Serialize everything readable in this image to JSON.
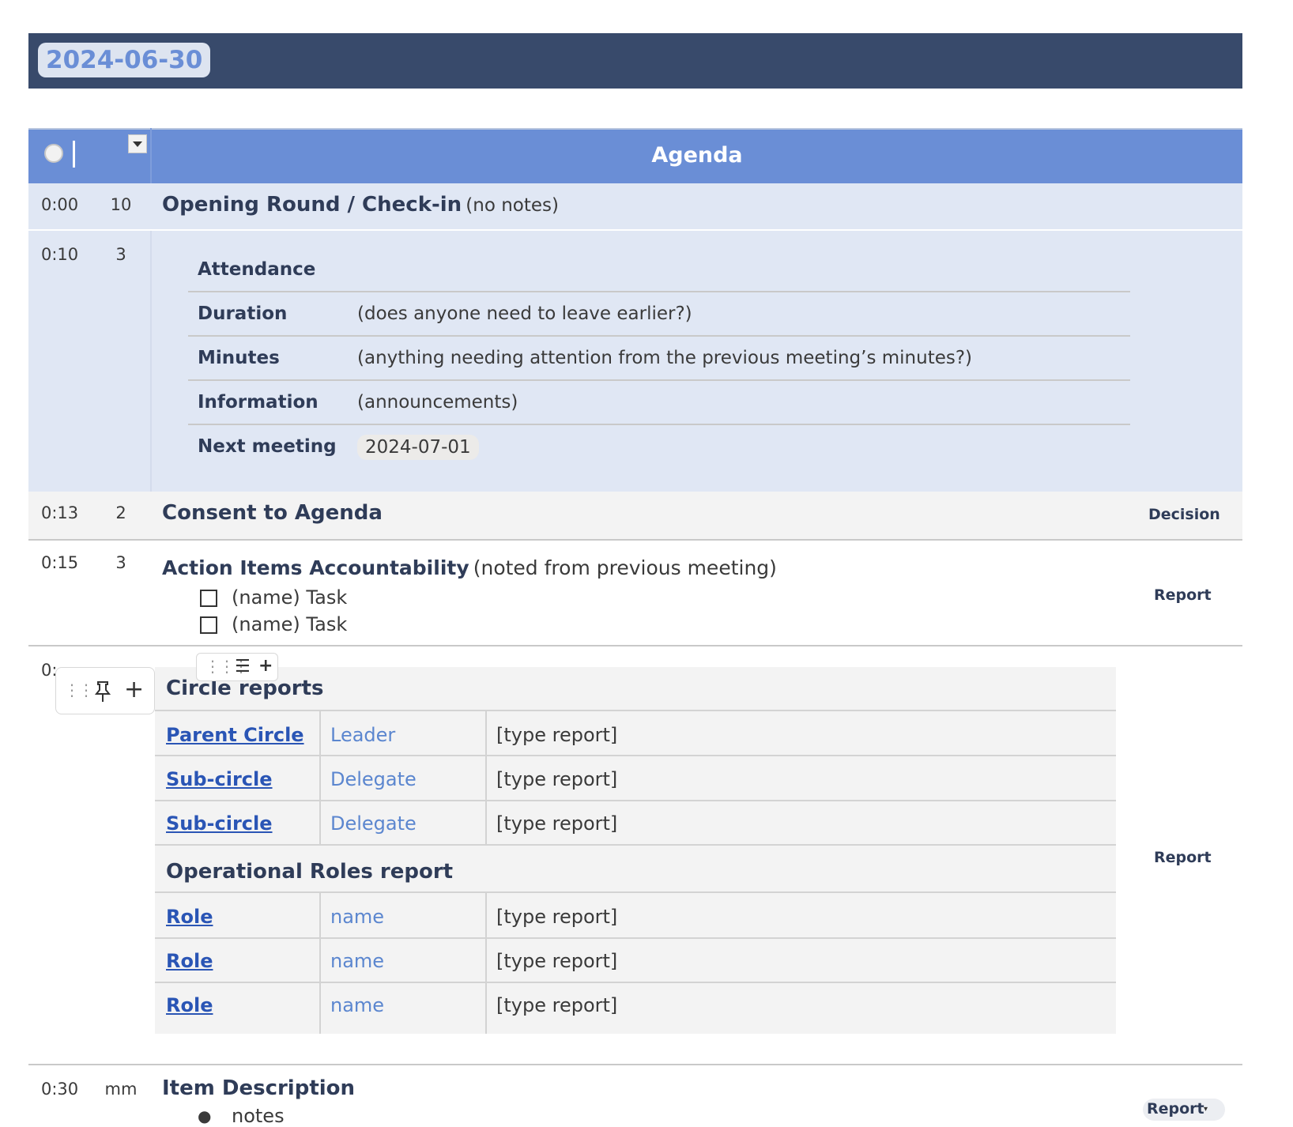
{
  "header": {
    "date": "2024-06-30",
    "agenda_title": "Agenda"
  },
  "icons": {
    "clock": "clock-icon",
    "dropdown": "dropdown-icon",
    "pin": "pin-icon",
    "add": "plus-icon",
    "drag": "drag-handle-icon",
    "align": "align-icon"
  },
  "rows": [
    {
      "time": "0:00",
      "duration": "10",
      "title": "Opening Round / Check-in",
      "note": "(no notes)"
    },
    {
      "time": "0:10",
      "duration": "3"
    },
    {
      "time": "0:13",
      "duration": "2",
      "title": "Consent to Agenda",
      "type": "Decision"
    },
    {
      "time": "0:15",
      "duration": "3",
      "title": "Action Items Accountability",
      "note": "(noted from previous meeting)",
      "type": "Report",
      "tasks": [
        "(name) Task",
        "(name) Task"
      ]
    },
    {
      "time": "0:",
      "type": "Report"
    },
    {
      "time": "0:30",
      "duration": "mm",
      "title": "Item Description",
      "bullet": "notes",
      "type": "Report"
    }
  ],
  "attendance": {
    "title": "Attendance",
    "items": [
      {
        "label": "Duration",
        "value": "(does anyone need to leave earlier?)"
      },
      {
        "label": "Minutes",
        "value": "(anything needing attention from the previous meeting’s minutes?)"
      },
      {
        "label": "Information",
        "value": "(announcements)"
      },
      {
        "label": "Next meeting",
        "value": "2024-07-01"
      }
    ]
  },
  "circle_reports": {
    "title": "Circle reports",
    "rows": [
      {
        "name": "Parent Circle",
        "role": "Leader",
        "report": "[type report]"
      },
      {
        "name": "Sub-circle",
        "role": "Delegate",
        "report": "[type report]"
      },
      {
        "name": "Sub-circle",
        "role": "Delegate",
        "report": "[type report]"
      }
    ]
  },
  "operational_roles": {
    "title": "Operational Roles report",
    "rows": [
      {
        "name": "Role",
        "role": "name",
        "report": "[type report]"
      },
      {
        "name": "Role",
        "role": "name",
        "report": "[type report]"
      },
      {
        "name": "Role",
        "role": "name",
        "report": "[type report]"
      }
    ]
  }
}
